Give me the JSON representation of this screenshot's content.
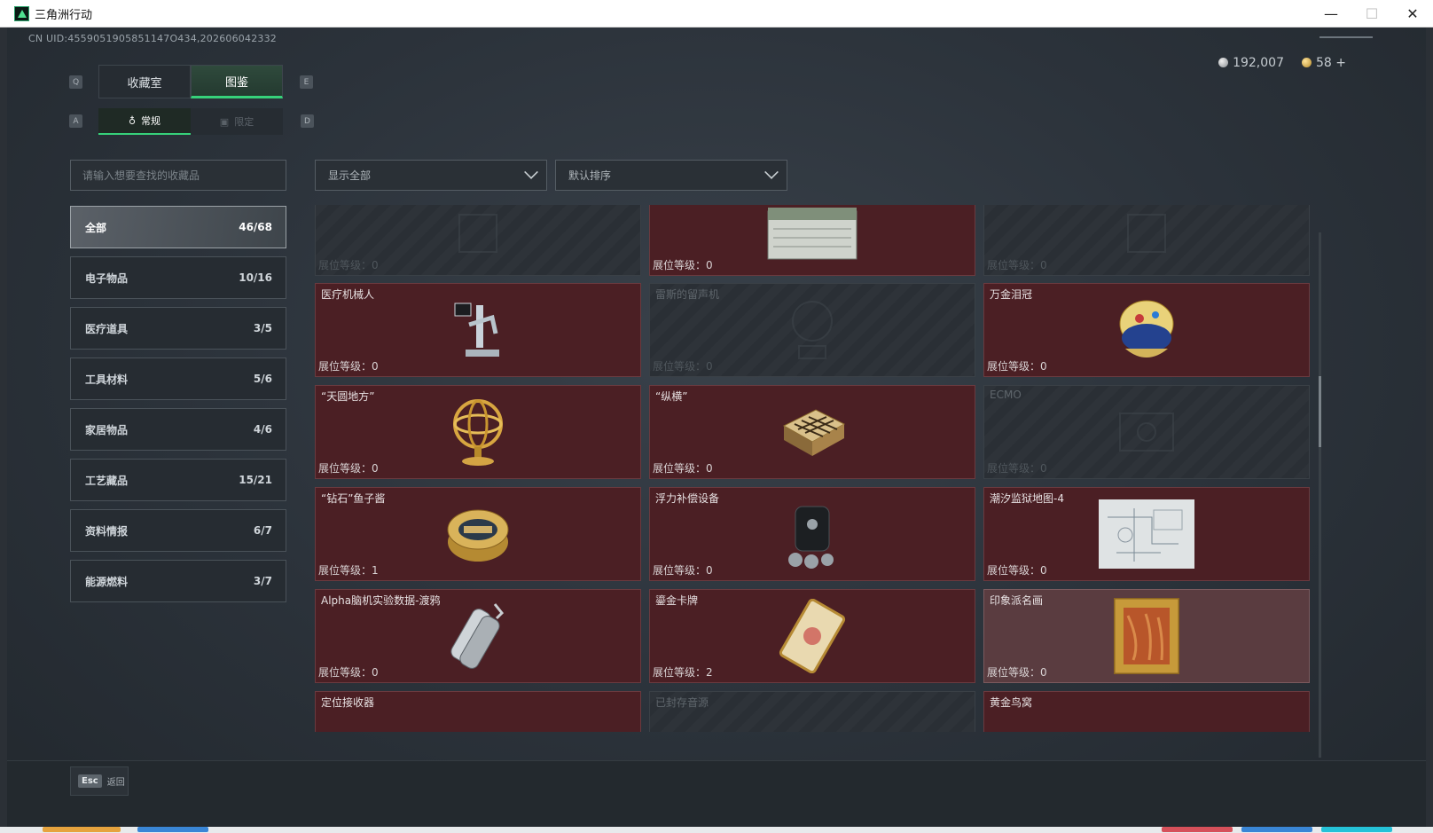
{
  "window": {
    "title": "三角洲行动",
    "min_glyph": "—",
    "max_glyph": "☐",
    "close_glyph": "✕"
  },
  "header": {
    "uid": "CN UID:4559051905851147O434,202606042332",
    "silver": "192,007",
    "gold": "58",
    "gold_add": "+"
  },
  "tabs": {
    "key_left": "Q",
    "key_right": "E",
    "items": [
      {
        "label": "收藏室",
        "active": false
      },
      {
        "label": "图鉴",
        "active": true
      }
    ]
  },
  "subtabs": {
    "key_left": "A",
    "key_right": "D",
    "items": [
      {
        "label": "常规",
        "icon": "♁",
        "active": true
      },
      {
        "label": "限定",
        "icon": "▣",
        "active": false
      }
    ]
  },
  "search": {
    "placeholder": "请输入想要查找的收藏品"
  },
  "categories": [
    {
      "label": "全部",
      "count": "46/68",
      "active": true
    },
    {
      "label": "电子物品",
      "count": "10/16",
      "active": false
    },
    {
      "label": "医疗道具",
      "count": "3/5",
      "active": false
    },
    {
      "label": "工具材料",
      "count": "5/6",
      "active": false
    },
    {
      "label": "家居物品",
      "count": "4/6",
      "active": false
    },
    {
      "label": "工艺藏品",
      "count": "15/21",
      "active": false
    },
    {
      "label": "资料情报",
      "count": "6/7",
      "active": false
    },
    {
      "label": "能源燃料",
      "count": "3/7",
      "active": false
    }
  ],
  "filters": {
    "show": "显示全部",
    "sort": "默认排序"
  },
  "level_prefix": "展位等级：",
  "cards": [
    {
      "name": "",
      "level": "0",
      "state": "locked",
      "icon": "locked-item-icon"
    },
    {
      "name": "",
      "level": "0",
      "state": "owned",
      "icon": "ammo-crate-icon"
    },
    {
      "name": "",
      "level": "0",
      "state": "locked",
      "icon": "locked-item-icon"
    },
    {
      "name": "医疗机械人",
      "level": "0",
      "state": "owned",
      "icon": "medical-robot-icon"
    },
    {
      "name": "雷斯的留声机",
      "level": "0",
      "state": "locked",
      "icon": "gramophone-icon"
    },
    {
      "name": "万金泪冠",
      "level": "0",
      "state": "owned",
      "icon": "jeweled-egg-icon"
    },
    {
      "name": "“天圆地方”",
      "level": "0",
      "state": "owned",
      "icon": "armillary-sphere-icon"
    },
    {
      "name": "“纵横”",
      "level": "0",
      "state": "owned",
      "icon": "chess-box-icon"
    },
    {
      "name": "ECMO",
      "level": "0",
      "state": "locked",
      "icon": "ecmo-icon"
    },
    {
      "name": "“钻石”鱼子酱",
      "level": "1",
      "state": "owned",
      "icon": "caviar-tin-icon"
    },
    {
      "name": "浮力补偿设备",
      "level": "0",
      "state": "owned",
      "icon": "buoyancy-device-icon"
    },
    {
      "name": "潮汐监狱地图-4",
      "level": "0",
      "state": "owned",
      "icon": "prison-map-icon"
    },
    {
      "name": "Alpha脑机实验数据-渡鸦",
      "level": "0",
      "state": "owned",
      "icon": "data-canister-icon"
    },
    {
      "name": "鎏金卡牌",
      "level": "2",
      "state": "owned",
      "icon": "gilded-card-icon"
    },
    {
      "name": "印象派名画",
      "level": "0",
      "state": "pale",
      "icon": "framed-painting-icon"
    },
    {
      "name": "定位接收器",
      "level": "",
      "state": "owned",
      "icon": "receiver-icon"
    },
    {
      "name": "已封存音源",
      "level": "",
      "state": "locked",
      "icon": "sealed-audio-icon"
    },
    {
      "name": "黄金鸟窝",
      "level": "",
      "state": "owned",
      "icon": "golden-nest-icon"
    }
  ],
  "footer": {
    "esc_key": "Esc",
    "esc_label": "返回"
  },
  "colors": {
    "accent": "#36d17a",
    "card_owned": "#4b1f24",
    "card_locked": "#2e3339"
  }
}
